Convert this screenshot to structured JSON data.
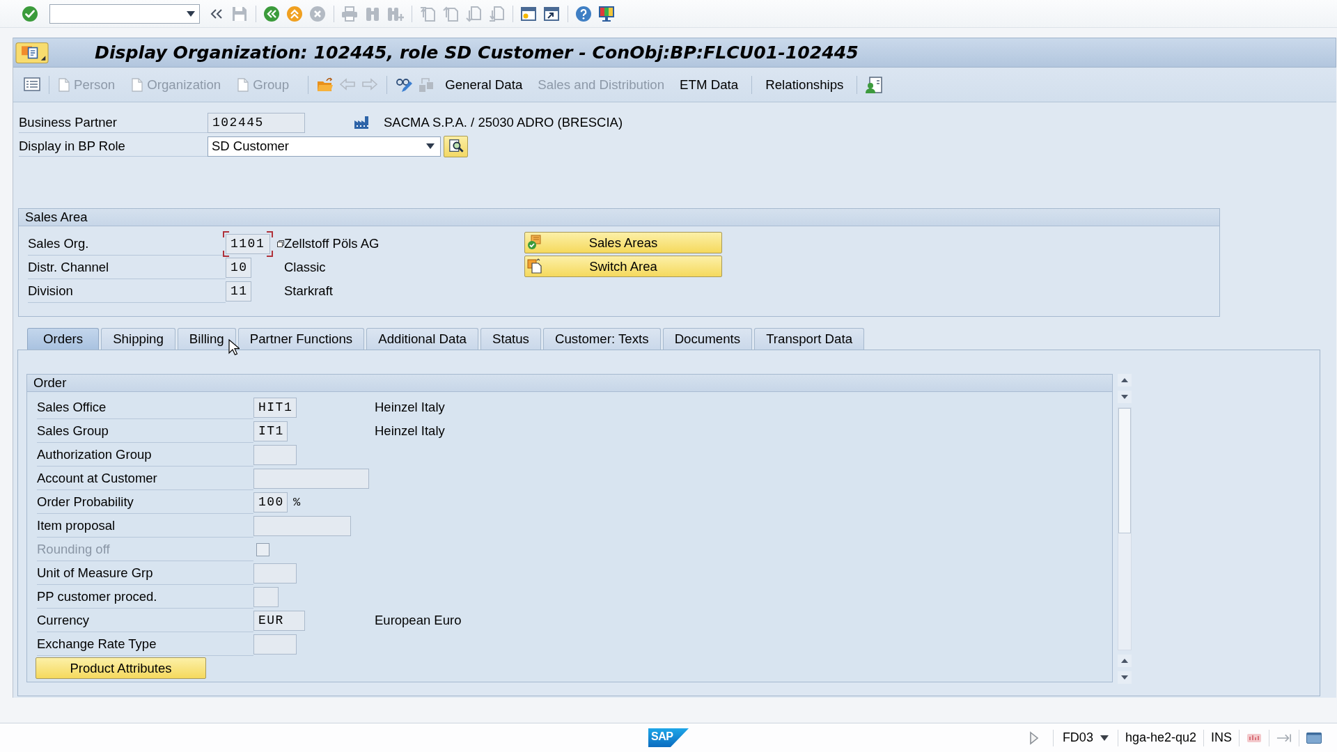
{
  "system_toolbar": {
    "items": [
      {
        "kind": "enter",
        "disabled": false
      },
      {
        "kind": "command"
      },
      {
        "kind": "collapse",
        "disabled": false
      },
      {
        "kind": "save",
        "disabled": true
      },
      {
        "kind": "separator"
      },
      {
        "kind": "back",
        "disabled": false
      },
      {
        "kind": "exit",
        "disabled": false
      },
      {
        "kind": "cancel",
        "disabled": true
      },
      {
        "kind": "separator"
      },
      {
        "kind": "print",
        "disabled": true
      },
      {
        "kind": "find",
        "disabled": true
      },
      {
        "kind": "findnext",
        "disabled": true
      },
      {
        "kind": "separator"
      },
      {
        "kind": "firstpage",
        "disabled": true
      },
      {
        "kind": "prevpage",
        "disabled": true
      },
      {
        "kind": "nextpage",
        "disabled": true
      },
      {
        "kind": "lastpage",
        "disabled": true
      },
      {
        "kind": "separator"
      },
      {
        "kind": "session",
        "disabled": false
      },
      {
        "kind": "shortcut",
        "disabled": false
      },
      {
        "kind": "separator"
      },
      {
        "kind": "help",
        "disabled": false
      },
      {
        "kind": "layout",
        "disabled": false
      }
    ]
  },
  "title_bar": {
    "title": "Display Organization: 102445, role SD Customer - ConObj:BP:FLCU01-102445"
  },
  "app_toolbar": {
    "items": [
      {
        "kind": "tree",
        "disabled": false
      },
      {
        "kind": "separator"
      },
      {
        "kind": "link",
        "label": "Person",
        "disabled": true
      },
      {
        "kind": "link",
        "label": "Organization",
        "disabled": true
      },
      {
        "kind": "link",
        "label": "Group",
        "disabled": true
      },
      {
        "kind": "separator"
      },
      {
        "kind": "open",
        "disabled": false
      },
      {
        "kind": "back",
        "disabled": true
      },
      {
        "kind": "forward",
        "disabled": true
      },
      {
        "kind": "separator"
      },
      {
        "kind": "edit",
        "disabled": false
      },
      {
        "kind": "switch",
        "disabled": true
      },
      {
        "kind": "view",
        "label": "General Data",
        "disabled": false
      },
      {
        "kind": "view",
        "label": "Sales and Distribution",
        "disabled": true
      },
      {
        "kind": "view",
        "label": "ETM Data",
        "disabled": false
      },
      {
        "kind": "separator"
      },
      {
        "kind": "view",
        "label": "Relationships",
        "disabled": false
      },
      {
        "kind": "separator"
      },
      {
        "kind": "contact",
        "disabled": false
      }
    ]
  },
  "header": {
    "business_partner": {
      "label": "Business Partner",
      "value": "102445",
      "description": "SACMA S.P.A. / 25030 ADRO (BRESCIA)"
    },
    "bp_role": {
      "label": "Display in BP Role",
      "value": "SD Customer"
    }
  },
  "sales_area": {
    "title": "Sales Area",
    "fields": [
      {
        "label": "Sales Org.",
        "value": "1101",
        "description": "Zellstoff Pöls AG",
        "focused": true
      },
      {
        "label": "Distr. Channel",
        "value": "10",
        "description": "Classic",
        "focused": false
      },
      {
        "label": "Division",
        "value": "11",
        "description": "Starkraft",
        "focused": false
      }
    ],
    "buttons": [
      {
        "kind": "areas",
        "label": "Sales Areas"
      },
      {
        "kind": "switch",
        "label": "Switch Area"
      }
    ]
  },
  "tabs": [
    {
      "label": "Orders",
      "selected": true
    },
    {
      "label": "Shipping",
      "selected": false
    },
    {
      "label": "Billing",
      "selected": false
    },
    {
      "label": "Partner Functions",
      "selected": false
    },
    {
      "label": "Additional Data",
      "selected": false
    },
    {
      "label": "Status",
      "selected": false
    },
    {
      "label": "Customer: Texts",
      "selected": false
    },
    {
      "label": "Documents",
      "selected": false
    },
    {
      "label": "Transport Data",
      "selected": false
    }
  ],
  "order": {
    "title": "Order",
    "fields": [
      {
        "kind": "input",
        "label": "Sales Office",
        "value": "HIT1",
        "description": "Heinzel Italy",
        "disabled": false
      },
      {
        "kind": "input",
        "label": "Sales Group",
        "value": "IT1",
        "description": "Heinzel Italy",
        "disabled": false
      },
      {
        "kind": "input",
        "label": "Authorization Group",
        "disabled": false
      },
      {
        "kind": "input",
        "label": "Account at Customer",
        "disabled": false
      },
      {
        "kind": "input",
        "label": "Order Probability",
        "value": "100",
        "unit": "%",
        "disabled": false
      },
      {
        "kind": "input",
        "label": "Item proposal",
        "disabled": false
      },
      {
        "kind": "checkbox",
        "label": "Rounding off",
        "checked": false,
        "disabled": true
      },
      {
        "kind": "input",
        "label": "Unit of Measure Grp",
        "disabled": false
      },
      {
        "kind": "input",
        "label": "PP customer proced.",
        "disabled": false
      },
      {
        "kind": "input",
        "label": "Currency",
        "value": "EUR",
        "description": "European Euro",
        "disabled": false
      },
      {
        "kind": "input",
        "label": "Exchange Rate Type",
        "disabled": false
      }
    ],
    "button": "Product Attributes"
  },
  "status_bar": {
    "logo": "SAP",
    "transaction": "FD03",
    "server": "hga-he2-qu2",
    "mode": "INS"
  }
}
